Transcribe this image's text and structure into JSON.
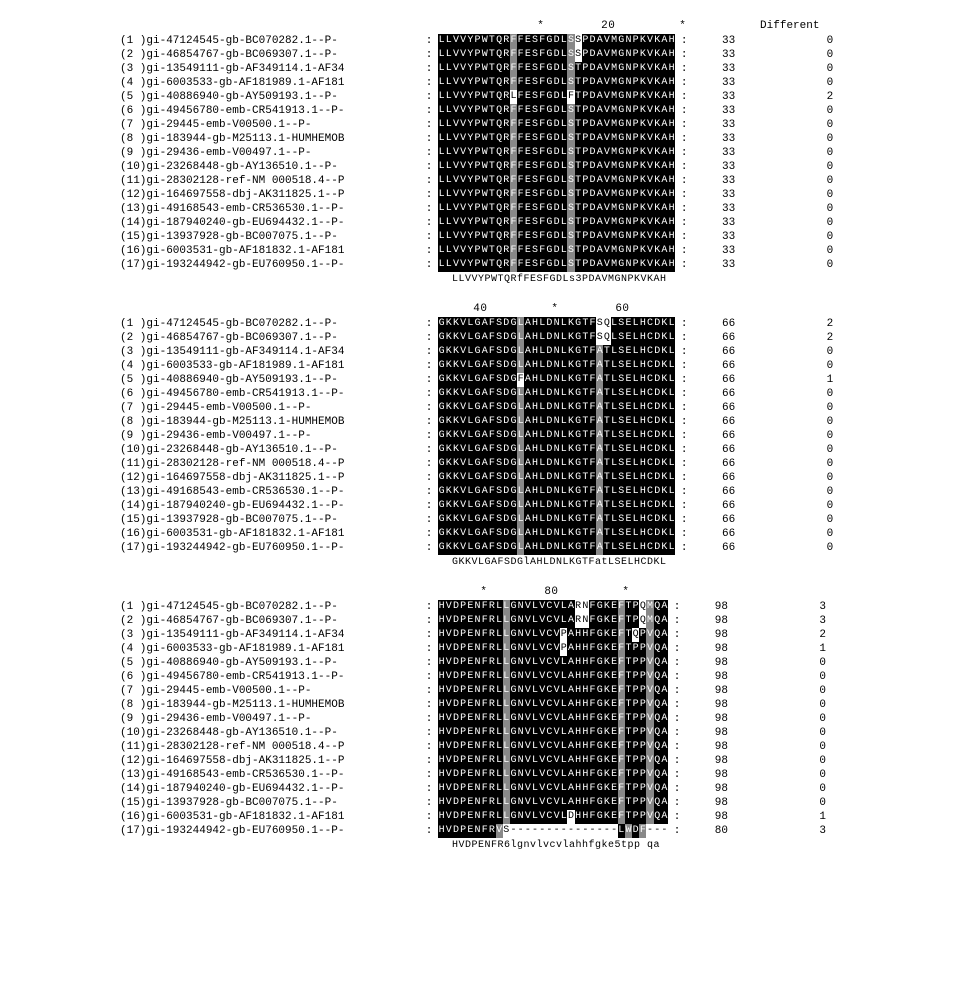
{
  "diff_header": "Different",
  "labels": [
    "(1 )gi-47124545-gb-BC070282.1--P-",
    "(2 )gi-46854767-gb-BC069307.1--P-",
    "(3 )gi-13549111-gb-AF349114.1-AF34",
    "(4 )gi-6003533-gb-AF181989.1-AF181",
    "(5 )gi-40886940-gb-AY509193.1--P-",
    "(6 )gi-49456780-emb-CR541913.1--P-",
    "(7 )gi-29445-emb-V00500.1--P-",
    "(8 )gi-183944-gb-M25113.1-HUMHEMOB",
    "(9 )gi-29436-emb-V00497.1--P-",
    "(10)gi-23268448-gb-AY136510.1--P-",
    "(11)gi-28302128-ref-NM 000518.4--P",
    "(12)gi-164697558-dbj-AK311825.1--P",
    "(13)gi-49168543-emb-CR536530.1--P-",
    "(14)gi-187940240-gb-EU694432.1--P-",
    "(15)gi-13937928-gb-BC007075.1--P-",
    "(16)gi-6003531-gb-AF181832.1-AF181",
    "(17)gi-193244942-gb-EU760950.1--P-"
  ],
  "blocks": [
    {
      "ruler": "            *        20         *       ",
      "consensus": "LLVVYPWTQRfFESFGDLs3PDAVMGNPKVKAH",
      "rows": [
        {
          "seq": "LLVVYPWTQRFFESFGDLSSPDAVMGNPKVKAH",
          "shade": "kkkkkkkkkkgkkkkkkkgwkkkkkkkkkkkkk",
          "pos": "33",
          "diff": "0"
        },
        {
          "seq": "LLVVYPWTQRFFESFGDLSSPDAVMGNPKVKAH",
          "shade": "kkkkkkkkkkgkkkkkkkgwkkkkkkkkkkkkk",
          "pos": "33",
          "diff": "0"
        },
        {
          "seq": "LLVVYPWTQRFFESFGDLSTPDAVMGNPKVKAH",
          "shade": "kkkkkkkkkkgkkkkkkkgkkkkkkkkkkkkkk",
          "pos": "33",
          "diff": "0"
        },
        {
          "seq": "LLVVYPWTQRFFESFGDLSTPDAVMGNPKVKAH",
          "shade": "kkkkkkkkkkgkkkkkkkgkkkkkkkkkkkkkk",
          "pos": "33",
          "diff": "0"
        },
        {
          "seq": "LLVVYPWTQRLFESFGDLFTPDAVMGNPKVKAH",
          "shade": "kkkkkkkkkkwkkkkkkkwkkkkkkkkkkkkkk",
          "pos": "33",
          "diff": "2"
        },
        {
          "seq": "LLVVYPWTQRFFESFGDLSTPDAVMGNPKVKAH",
          "shade": "kkkkkkkkkkgkkkkkkkgkkkkkkkkkkkkkk",
          "pos": "33",
          "diff": "0"
        },
        {
          "seq": "LLVVYPWTQRFFESFGDLSTPDAVMGNPKVKAH",
          "shade": "kkkkkkkkkkgkkkkkkkgkkkkkkkkkkkkkk",
          "pos": "33",
          "diff": "0"
        },
        {
          "seq": "LLVVYPWTQRFFESFGDLSTPDAVMGNPKVKAH",
          "shade": "kkkkkkkkkkgkkkkkkkgkkkkkkkkkkkkkk",
          "pos": "33",
          "diff": "0"
        },
        {
          "seq": "LLVVYPWTQRFFESFGDLSTPDAVMGNPKVKAH",
          "shade": "kkkkkkkkkkgkkkkkkkgkkkkkkkkkkkkkk",
          "pos": "33",
          "diff": "0"
        },
        {
          "seq": "LLVVYPWTQRFFESFGDLSTPDAVMGNPKVKAH",
          "shade": "kkkkkkkkkkgkkkkkkkgkkkkkkkkkkkkkk",
          "pos": "33",
          "diff": "0"
        },
        {
          "seq": "LLVVYPWTQRFFESFGDLSTPDAVMGNPKVKAH",
          "shade": "kkkkkkkkkkgkkkkkkkgkkkkkkkkkkkkkk",
          "pos": "33",
          "diff": "0"
        },
        {
          "seq": "LLVVYPWTQRFFESFGDLSTPDAVMGNPKVKAH",
          "shade": "kkkkkkkkkkgkkkkkkkgkkkkkkkkkkkkkk",
          "pos": "33",
          "diff": "0"
        },
        {
          "seq": "LLVVYPWTQRFFESFGDLSTPDAVMGNPKVKAH",
          "shade": "kkkkkkkkkkgkkkkkkkgkkkkkkkkkkkkkk",
          "pos": "33",
          "diff": "0"
        },
        {
          "seq": "LLVVYPWTQRFFESFGDLSTPDAVMGNPKVKAH",
          "shade": "kkkkkkkkkkgkkkkkkkgkkkkkkkkkkkkkk",
          "pos": "33",
          "diff": "0"
        },
        {
          "seq": "LLVVYPWTQRFFESFGDLSTPDAVMGNPKVKAH",
          "shade": "kkkkkkkkkkgkkkkkkkgkkkkkkkkkkkkkk",
          "pos": "33",
          "diff": "0"
        },
        {
          "seq": "LLVVYPWTQRFFESFGDLSTPDAVMGNPKVKAH",
          "shade": "kkkkkkkkkkgkkkkkkkgkkkkkkkkkkkkkk",
          "pos": "33",
          "diff": "0"
        },
        {
          "seq": "LLVVYPWTQRFFESFGDLSTPDAVMGNPKVKAH",
          "shade": "kkkkkkkkkkgkkkkkkkgkkkkkkkkkkkkkk",
          "pos": "33",
          "diff": "0"
        }
      ]
    },
    {
      "ruler": "   40         *        60        ",
      "consensus": "GKKVLGAFSDGlAHLDNLKGTFatLSELHCDKL",
      "rows": [
        {
          "seq": "GKKVLGAFSDGLAHLDNLKGTFSQLSELHCDKL",
          "shade": "kkkkkkkkkkkgkkkkkkkkkkwwkkkkkkkkk",
          "pos": "66",
          "diff": "2"
        },
        {
          "seq": "GKKVLGAFSDGLAHLDNLKGTFSQLSELHCDKL",
          "shade": "kkkkkkkkkkkgkkkkkkkkkkwwkkkkkkkkk",
          "pos": "66",
          "diff": "2"
        },
        {
          "seq": "GKKVLGAFSDGLAHLDNLKGTFATLSELHCDKL",
          "shade": "kkkkkkkkkkkgkkkkkkkkkkgkkkkkkkkkk",
          "pos": "66",
          "diff": "0"
        },
        {
          "seq": "GKKVLGAFSDGLAHLDNLKGTFATLSELHCDKL",
          "shade": "kkkkkkkkkkkgkkkkkkkkkkgkkkkkkkkkk",
          "pos": "66",
          "diff": "0"
        },
        {
          "seq": "GKKVLGAFSDGFAHLDNLKGTFATLSELHCDKL",
          "shade": "kkkkkkkkkkkwkkkkkkkkkkgkkkkkkkkkk",
          "pos": "66",
          "diff": "1"
        },
        {
          "seq": "GKKVLGAFSDGLAHLDNLKGTFATLSELHCDKL",
          "shade": "kkkkkkkkkkkgkkkkkkkkkkgkkkkkkkkkk",
          "pos": "66",
          "diff": "0"
        },
        {
          "seq": "GKKVLGAFSDGLAHLDNLKGTFATLSELHCDKL",
          "shade": "kkkkkkkkkkkgkkkkkkkkkkgkkkkkkkkkk",
          "pos": "66",
          "diff": "0"
        },
        {
          "seq": "GKKVLGAFSDGLAHLDNLKGTFATLSELHCDKL",
          "shade": "kkkkkkkkkkkgkkkkkkkkkkgkkkkkkkkkk",
          "pos": "66",
          "diff": "0"
        },
        {
          "seq": "GKKVLGAFSDGLAHLDNLKGTFATLSELHCDKL",
          "shade": "kkkkkkkkkkkgkkkkkkkkkkgkkkkkkkkkk",
          "pos": "66",
          "diff": "0"
        },
        {
          "seq": "GKKVLGAFSDGLAHLDNLKGTFATLSELHCDKL",
          "shade": "kkkkkkkkkkkgkkkkkkkkkkgkkkkkkkkkk",
          "pos": "66",
          "diff": "0"
        },
        {
          "seq": "GKKVLGAFSDGLAHLDNLKGTFATLSELHCDKL",
          "shade": "kkkkkkkkkkkgkkkkkkkkkkgkkkkkkkkkk",
          "pos": "66",
          "diff": "0"
        },
        {
          "seq": "GKKVLGAFSDGLAHLDNLKGTFATLSELHCDKL",
          "shade": "kkkkkkkkkkkgkkkkkkkkkkgkkkkkkkkkk",
          "pos": "66",
          "diff": "0"
        },
        {
          "seq": "GKKVLGAFSDGLAHLDNLKGTFATLSELHCDKL",
          "shade": "kkkkkkkkkkkgkkkkkkkkkkgkkkkkkkkkk",
          "pos": "66",
          "diff": "0"
        },
        {
          "seq": "GKKVLGAFSDGLAHLDNLKGTFATLSELHCDKL",
          "shade": "kkkkkkkkkkkgkkkkkkkkkkgkkkkkkkkkk",
          "pos": "66",
          "diff": "0"
        },
        {
          "seq": "GKKVLGAFSDGLAHLDNLKGTFATLSELHCDKL",
          "shade": "kkkkkkkkkkkgkkkkkkkkkkgkkkkkkkkkk",
          "pos": "66",
          "diff": "0"
        },
        {
          "seq": "GKKVLGAFSDGLAHLDNLKGTFATLSELHCDKL",
          "shade": "kkkkkkkkkkkgkkkkkkkkkkgkkkkkkkkkk",
          "pos": "66",
          "diff": "0"
        },
        {
          "seq": "GKKVLGAFSDGLAHLDNLKGTFATLSELHCDKL",
          "shade": "kkkkkkkkkkkgkkkkkkkkkkgkkkkkkkkkk",
          "pos": "66",
          "diff": "0"
        }
      ]
    },
    {
      "ruler": "    *        80         *        ",
      "consensus": "HVDPENFR6lgnvlvcvlahhfgke5tpp qa",
      "rows": [
        {
          "seq": "HVDPENFRLLGNVLVCVLARNFGKEFTPQMQA",
          "shade": "kkkkkkkkkgkkkkkkkkkwwkkkkgkkwgkk",
          "pos": "98",
          "diff": "3"
        },
        {
          "seq": "HVDPENFRLLGNVLVCVLARNFGKEFTPQMQA",
          "shade": "kkkkkkkkkgkkkkkkkkkwwkkkkgkkwgkk",
          "pos": "98",
          "diff": "3"
        },
        {
          "seq": "HVDPENFRLLGNVLVCVPAHHFGKEFTQPVQA",
          "shade": "kkkkkkkkkgkkkkkkkwkkkkkkkgkwkgkk",
          "pos": "98",
          "diff": "2"
        },
        {
          "seq": "HVDPENFRLLGNVLVCVPAHHFGKEFTPPVQA",
          "shade": "kkkkkkkkkgkkkkkkkwkkkkkkkgkkkgkk",
          "pos": "98",
          "diff": "1"
        },
        {
          "seq": "HVDPENFRLLGNVLVCVLAHHFGKEFTPPVQA",
          "shade": "kkkkkkkkkgkkkkkkkkkkkkkkkgkkkgkk",
          "pos": "98",
          "diff": "0"
        },
        {
          "seq": "HVDPENFRLLGNVLVCVLAHHFGKEFTPPVQA",
          "shade": "kkkkkkkkkgkkkkkkkkkkkkkkkgkkkgkk",
          "pos": "98",
          "diff": "0"
        },
        {
          "seq": "HVDPENFRLLGNVLVCVLAHHFGKEFTPPVQA",
          "shade": "kkkkkkkkkgkkkkkkkkkkkkkkkgkkkgkk",
          "pos": "98",
          "diff": "0"
        },
        {
          "seq": "HVDPENFRLLGNVLVCVLAHHFGKEFTPPVQA",
          "shade": "kkkkkkkkkgkkkkkkkkkkkkkkkgkkkgkk",
          "pos": "98",
          "diff": "0"
        },
        {
          "seq": "HVDPENFRLLGNVLVCVLAHHFGKEFTPPVQA",
          "shade": "kkkkkkkkkgkkkkkkkkkkkkkkkgkkkgkk",
          "pos": "98",
          "diff": "0"
        },
        {
          "seq": "HVDPENFRLLGNVLVCVLAHHFGKEFTPPVQA",
          "shade": "kkkkkkkkkgkkkkkkkkkkkkkkkgkkkgkk",
          "pos": "98",
          "diff": "0"
        },
        {
          "seq": "HVDPENFRLLGNVLVCVLAHHFGKEFTPPVQA",
          "shade": "kkkkkkkkkgkkkkkkkkkkkkkkkgkkkgkk",
          "pos": "98",
          "diff": "0"
        },
        {
          "seq": "HVDPENFRLLGNVLVCVLAHHFGKEFTPPVQA",
          "shade": "kkkkkkkkkgkkkkkkkkkkkkkkkgkkkgkk",
          "pos": "98",
          "diff": "0"
        },
        {
          "seq": "HVDPENFRLLGNVLVCVLAHHFGKEFTPPVQA",
          "shade": "kkkkkkkkkgkkkkkkkkkkkkkkkgkkkgkk",
          "pos": "98",
          "diff": "0"
        },
        {
          "seq": "HVDPENFRLLGNVLVCVLAHHFGKEFTPPVQA",
          "shade": "kkkkkkkkkgkkkkkkkkkkkkkkkgkkkgkk",
          "pos": "98",
          "diff": "0"
        },
        {
          "seq": "HVDPENFRLLGNVLVCVLAHHFGKEFTPPVQA",
          "shade": "kkkkkkkkkgkkkkkkkkkkkkkkkgkkkgkk",
          "pos": "98",
          "diff": "0"
        },
        {
          "seq": "HVDPENFRLLGNVLVCVLDHHFGKEFTPPVQA",
          "shade": "kkkkkkkkkgkkkkkkkkwkkkkkkgkkkgkk",
          "pos": "98",
          "diff": "1"
        },
        {
          "seq": "HVDPENFRVS---------------LWDF---",
          "shade": "kkkkkkkkgwwwwwwwwwwwwwwwwkgkgwww",
          "pos": "80",
          "diff": "3"
        }
      ]
    }
  ]
}
